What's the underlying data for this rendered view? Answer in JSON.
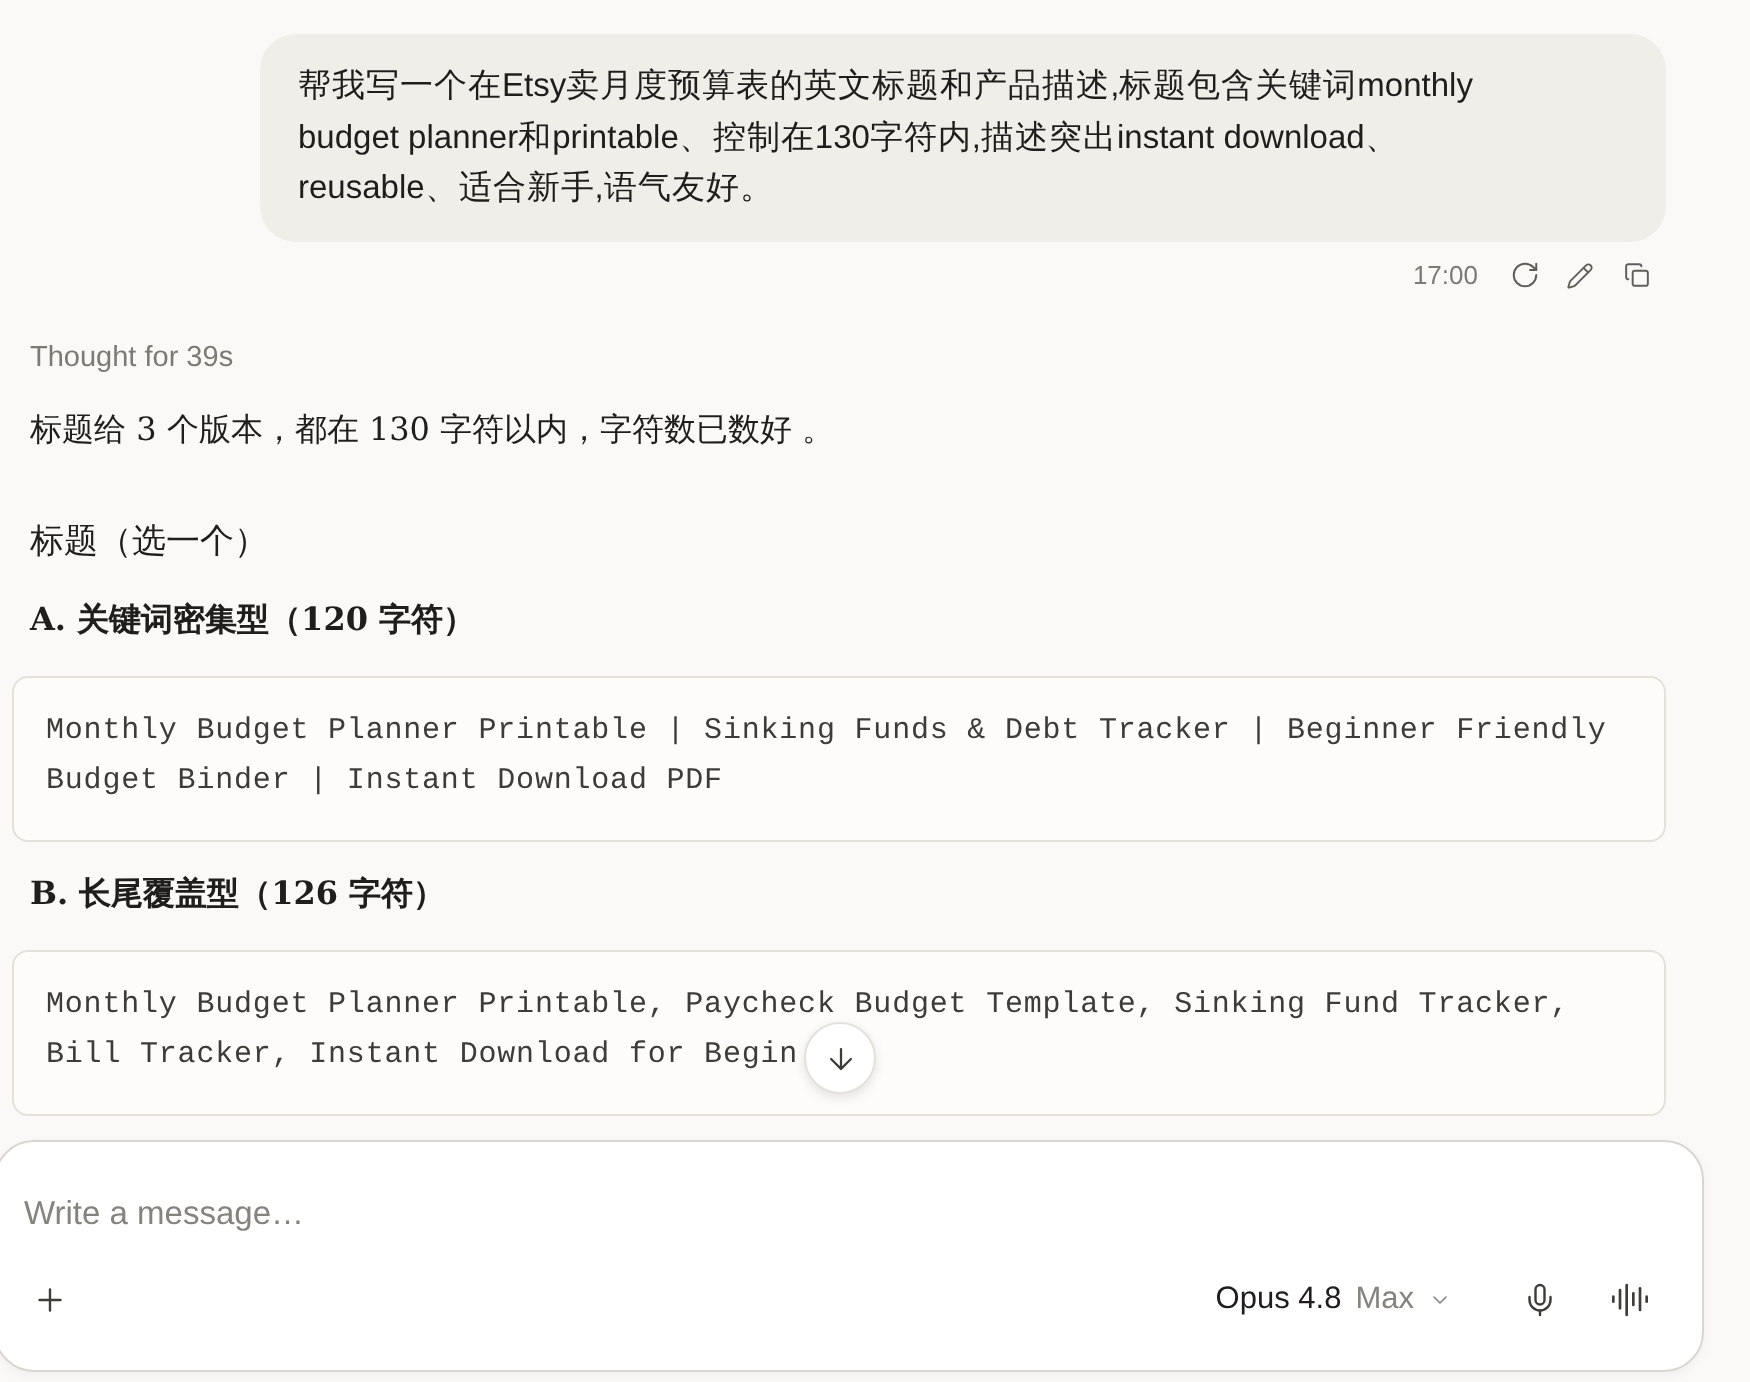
{
  "user_message": {
    "text": "帮我写一个在Etsy卖月度预算表的英文标题和产品描述,标题包含关键词monthly budget planner和printable、控制在130字符内,描述突出instant download、reusable、适合新手,语气友好。",
    "time": "17:00"
  },
  "response": {
    "thought_label": "Thought for 39s",
    "blocks": [
      {
        "kind": "paragraph",
        "text": "标题给 3 个版本，都在 130 字符以内，字符数已数好 。"
      },
      {
        "kind": "heading",
        "text": "标题（选一个）"
      },
      {
        "kind": "subheading",
        "text": "A. 关键词密集型（120 字符）"
      },
      {
        "kind": "code",
        "lines": [
          "Monthly Budget Planner Printable | Sinking Funds & Debt Tracker | Beginner Friendly",
          "Budget Binder | Instant Download PDF"
        ]
      },
      {
        "kind": "subheading",
        "text": "B. 长尾覆盖型（126 字符）"
      },
      {
        "kind": "code",
        "lines": [
          "Monthly Budget Planner Printable, Paycheck Budget Template, Sinking Fund Tracker,",
          "Bill Tracker, Instant Download for Begin"
        ]
      }
    ]
  },
  "composer": {
    "placeholder": "Write a message…",
    "model": "Opus 4.8",
    "effort": "Max"
  }
}
